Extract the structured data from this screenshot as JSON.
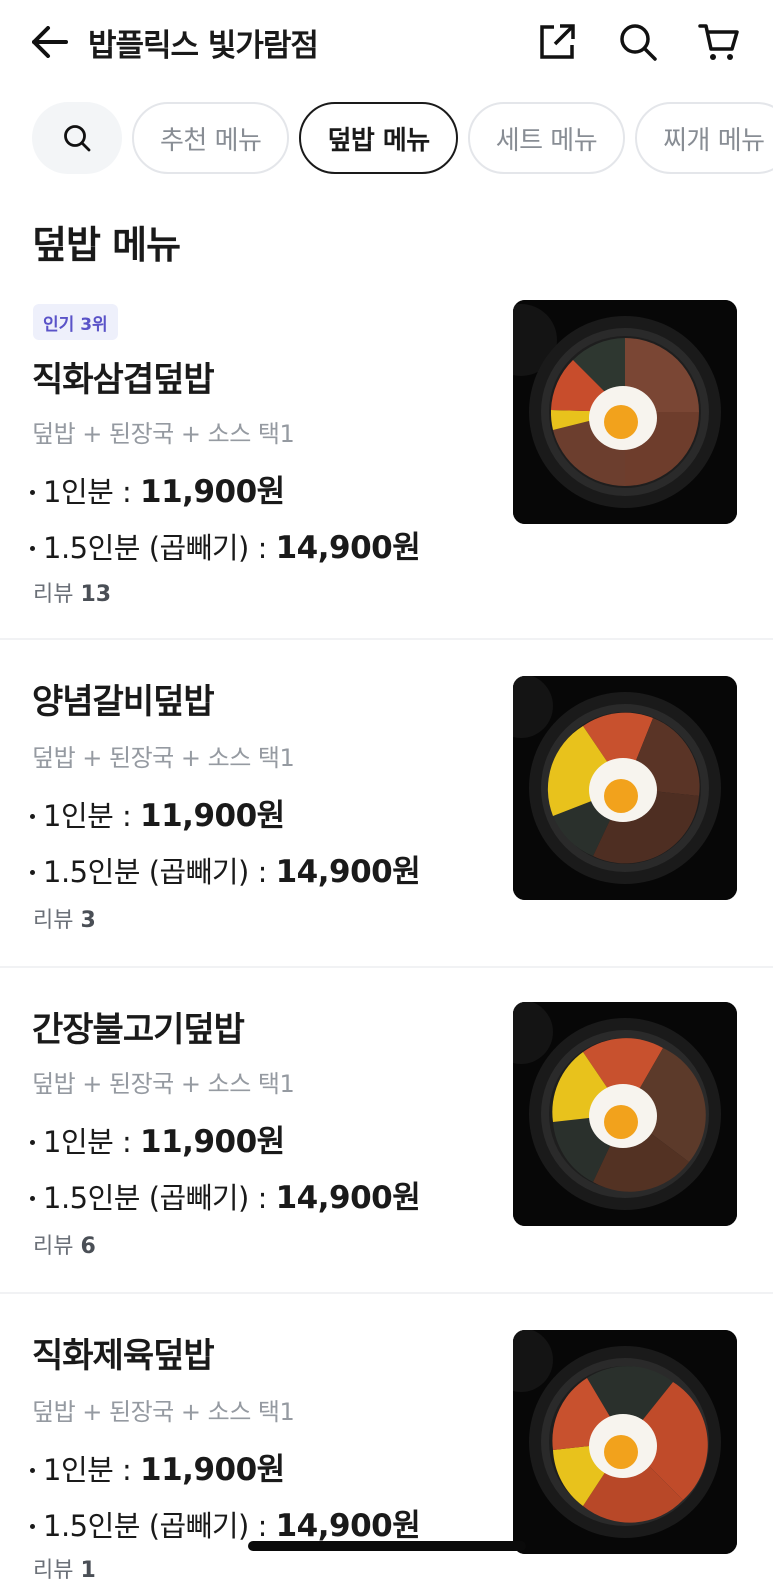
{
  "header": {
    "title": "밥플릭스 빛가람점",
    "icons": [
      "back-arrow-icon",
      "share-icon",
      "search-icon",
      "cart-icon"
    ]
  },
  "tabs": {
    "items": [
      {
        "label": "추천 메뉴",
        "active": false
      },
      {
        "label": "덮밥 메뉴",
        "active": true
      },
      {
        "label": "세트 메뉴",
        "active": false
      },
      {
        "label": "찌개 메뉴",
        "active": false
      }
    ]
  },
  "section": {
    "title": "덮밥 메뉴"
  },
  "menu": {
    "items": [
      {
        "badge": "인기 3위",
        "name": "직화삼겹덮밥",
        "desc": "덮밥 + 된장국 + 소스 택1",
        "price1_label": "1인분 :",
        "price1": "11,900원",
        "price2_label": "1.5인분 (곱빼기) :",
        "price2": "14,900원",
        "review_label": "리뷰",
        "review_count": "13"
      },
      {
        "name": "양념갈비덮밥",
        "desc": "덮밥 + 된장국 + 소스 택1",
        "price1_label": "1인분 :",
        "price1": "11,900원",
        "price2_label": "1.5인분 (곱빼기) :",
        "price2": "14,900원",
        "review_label": "리뷰",
        "review_count": "3"
      },
      {
        "name": "간장불고기덮밥",
        "desc": "덮밥 + 된장국 + 소스 택1",
        "price1_label": "1인분 :",
        "price1": "11,900원",
        "price2_label": "1.5인분 (곱빼기) :",
        "price2": "14,900원",
        "review_label": "리뷰",
        "review_count": "6"
      },
      {
        "name": "직화제육덮밥",
        "desc": "덮밥 + 된장국 + 소스 택1",
        "price1_label": "1인분 :",
        "price1": "11,900원",
        "price2_label": "1.5인분 (곱빼기) :",
        "price2": "14,900원",
        "review_label": "리뷰",
        "review_count": "1"
      }
    ]
  },
  "colors": {
    "accent_badge_bg": "#eef0fb",
    "accent_badge_text": "#5a53c8",
    "text_primary": "#1a1a1a",
    "text_secondary": "#959aa1"
  }
}
